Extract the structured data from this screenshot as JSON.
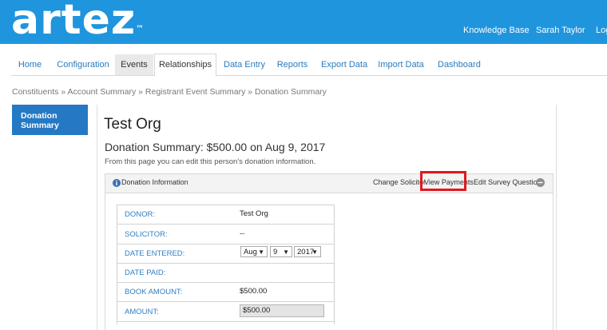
{
  "header": {
    "logo": "artez",
    "logo_tm": "™",
    "links": [
      "Knowledge Base",
      "Sarah Taylor",
      "Log"
    ]
  },
  "nav": {
    "tabs": [
      "Home",
      "Configuration",
      "Events",
      "Relationships",
      "Data Entry",
      "Reports",
      "Export Data",
      "Import Data",
      "Dashboard"
    ],
    "active": "Relationships"
  },
  "breadcrumb": "Constituents » Account Summary » Registrant Event Summary » Donation Summary",
  "sidebar": {
    "item": "Donation Summary"
  },
  "page": {
    "title": "Test Org",
    "subtitle": "Donation Summary: $500.00 on Aug 9, 2017",
    "description": "From this page you can edit this person's donation information."
  },
  "panel": {
    "title": "Donation Information",
    "actions": {
      "solicitor": "Change Solicitor",
      "payments": "View Payments",
      "survey": "Edit Survey Questions"
    }
  },
  "fields": {
    "donor": {
      "label": "DONOR:",
      "value": "Test Org"
    },
    "solicitor": {
      "label": "SOLICITOR:",
      "value": "--"
    },
    "date_entered": {
      "label": "DATE ENTERED:",
      "month": "Aug",
      "day": "9",
      "year": "2017"
    },
    "date_paid": {
      "label": "DATE PAID:",
      "value": ""
    },
    "book_amount": {
      "label": "BOOK AMOUNT:",
      "value": "$500.00"
    },
    "amount": {
      "label": "AMOUNT:",
      "value": "$500.00"
    }
  },
  "colors": {
    "brand": "#1f95de",
    "link": "#2a7bbd",
    "highlight": "#e0191f",
    "sidebar": "#2579c4"
  }
}
